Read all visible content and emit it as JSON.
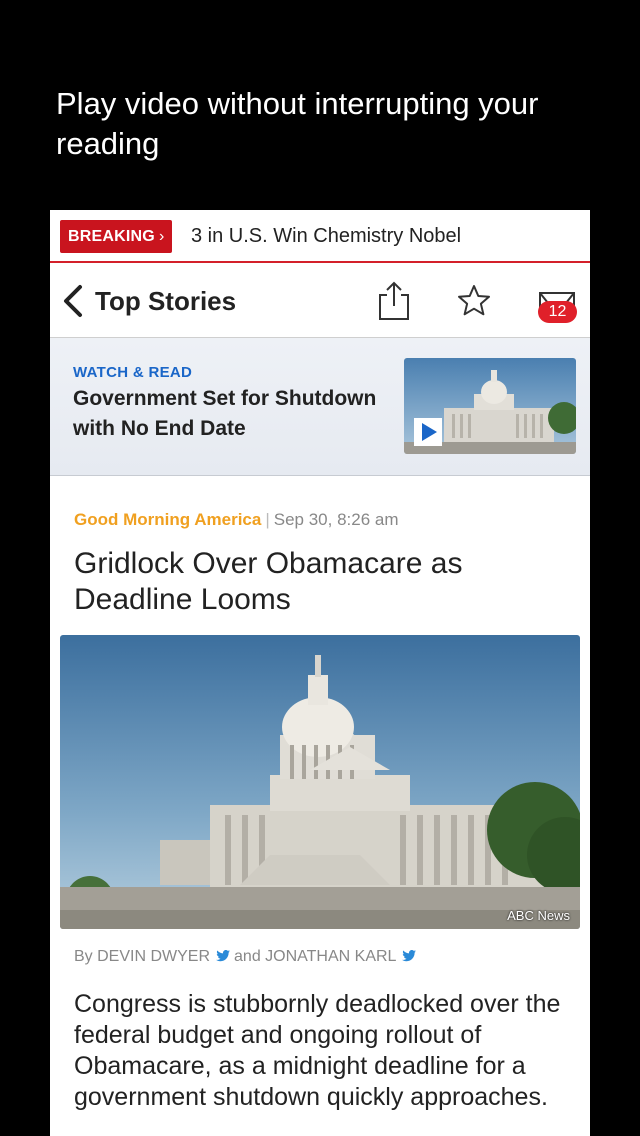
{
  "promo": {
    "caption": "Play video without interrupting your reading"
  },
  "breaking": {
    "tag": "BREAKING",
    "chevron": "›",
    "headline": "3 in U.S. Win Chemistry Nobel"
  },
  "nav": {
    "back_icon": "chevron-left-icon",
    "title": "Top Stories",
    "share_icon": "share-icon",
    "star_icon": "star-icon",
    "inbox_icon": "inbox-icon",
    "badge_count": "12"
  },
  "watch_read": {
    "kicker": "WATCH & READ",
    "title": "Government Set for Shutdown with No End Date",
    "play_icon": "play-icon"
  },
  "article": {
    "source": "Good Morning America",
    "separator": "|",
    "timestamp": "Sep 30, 8:26 am",
    "headline": "Gridlock Over Obamacare as Deadline Looms",
    "image_credit": "ABC News",
    "byline_prefix": "By DEVIN DWYER",
    "byline_and": "and JONATHAN KARL",
    "body": "Congress is stubbornly deadlocked over the federal budget and ongoing rollout of Obamacare, as a midnight deadline for a government shutdown quickly approaches."
  },
  "colors": {
    "breaking_red": "#c9141e",
    "accent_blue": "#1a66c8",
    "source_orange": "#f0a020",
    "twitter_blue": "#2a8ad8"
  }
}
